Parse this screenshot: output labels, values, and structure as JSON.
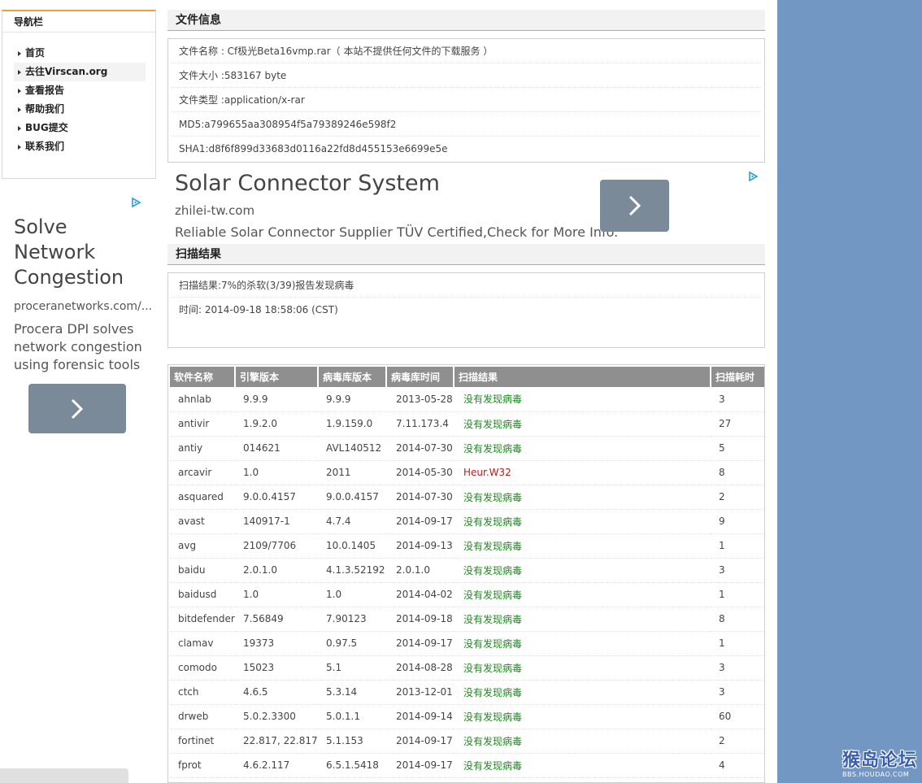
{
  "nav": {
    "title": "导航栏",
    "items": [
      {
        "label": "首页"
      },
      {
        "label": "去往Virscan.org"
      },
      {
        "label": "查看报告"
      },
      {
        "label": "帮助我们"
      },
      {
        "label": "BUG提交"
      },
      {
        "label": "联系我们"
      }
    ]
  },
  "ad_left": {
    "title": "Solve Network Congestion",
    "domain": "proceranetworks.com/...",
    "description": "Procera DPI solves network congestion using forensic tools"
  },
  "file_info": {
    "heading": "文件信息",
    "rows": [
      "文件名称 : Cf极光Beta16vmp.rar（ 本站不提供任何文件的下载服务 ）",
      "文件大小 :583167 byte",
      "文件类型 :application/x-rar",
      "MD5:a799655aa308954f5a79389246e598f2",
      "SHA1:d8f6f899d33683d0116a22fd8d455153e6699e5e"
    ]
  },
  "ad_top": {
    "title": "Solar Connector System",
    "domain": "zhilei-tw.com",
    "description": "Reliable Solar Connector Supplier TÜV Certified,Check for More Info."
  },
  "scan": {
    "heading": "扫描结果",
    "summary": "扫描结果:7%的杀软(3/39)报告发现病毒",
    "time": "时间: 2014-09-18 18:58:06 (CST)"
  },
  "results_table": {
    "headers": [
      "软件名称",
      "引擎版本",
      "病毒库版本",
      "病毒库时间",
      "扫描结果",
      "扫描耗时"
    ],
    "rows": [
      {
        "name": "ahnlab",
        "engine": "9.9.9",
        "db_version": "9.9.9",
        "db_time": "2013-05-28",
        "result": "没有发现病毒",
        "status": "ok",
        "duration": "3"
      },
      {
        "name": "antivir",
        "engine": "1.9.2.0",
        "db_version": "1.9.159.0",
        "db_time": "7.11.173.4",
        "result": "没有发现病毒",
        "status": "ok",
        "duration": "27"
      },
      {
        "name": "antiy",
        "engine": "014621",
        "db_version": "AVL140512",
        "db_time": "2014-07-30",
        "result": "没有发现病毒",
        "status": "ok",
        "duration": "5"
      },
      {
        "name": "arcavir",
        "engine": "1.0",
        "db_version": "2011",
        "db_time": "2014-05-30",
        "result": "Heur.W32",
        "status": "bad",
        "duration": "8"
      },
      {
        "name": "asquared",
        "engine": "9.0.0.4157",
        "db_version": "9.0.0.4157",
        "db_time": "2014-07-30",
        "result": "没有发现病毒",
        "status": "ok",
        "duration": "2"
      },
      {
        "name": "avast",
        "engine": "140917-1",
        "db_version": "4.7.4",
        "db_time": "2014-09-17",
        "result": "没有发现病毒",
        "status": "ok",
        "duration": "9"
      },
      {
        "name": "avg",
        "engine": "2109/7706",
        "db_version": "10.0.1405",
        "db_time": "2014-09-13",
        "result": "没有发现病毒",
        "status": "ok",
        "duration": "1"
      },
      {
        "name": "baidu",
        "engine": "2.0.1.0",
        "db_version": "4.1.3.52192",
        "db_time": "2.0.1.0",
        "result": "没有发现病毒",
        "status": "ok",
        "duration": "3"
      },
      {
        "name": "baidusd",
        "engine": "1.0",
        "db_version": "1.0",
        "db_time": "2014-04-02",
        "result": "没有发现病毒",
        "status": "ok",
        "duration": "1"
      },
      {
        "name": "bitdefender",
        "engine": "7.56849",
        "db_version": "7.90123",
        "db_time": "2014-09-18",
        "result": "没有发现病毒",
        "status": "ok",
        "duration": "8"
      },
      {
        "name": "clamav",
        "engine": "19373",
        "db_version": "0.97.5",
        "db_time": "2014-09-17",
        "result": "没有发现病毒",
        "status": "ok",
        "duration": "1"
      },
      {
        "name": "comodo",
        "engine": "15023",
        "db_version": "5.1",
        "db_time": "2014-08-28",
        "result": "没有发现病毒",
        "status": "ok",
        "duration": "3"
      },
      {
        "name": "ctch",
        "engine": "4.6.5",
        "db_version": "5.3.14",
        "db_time": "2013-12-01",
        "result": "没有发现病毒",
        "status": "ok",
        "duration": "3"
      },
      {
        "name": "drweb",
        "engine": "5.0.2.3300",
        "db_version": "5.0.1.1",
        "db_time": "2014-09-14",
        "result": "没有发现病毒",
        "status": "ok",
        "duration": "60"
      },
      {
        "name": "fortinet",
        "engine": "22.817, 22.817",
        "db_version": "5.1.153",
        "db_time": "2014-09-17",
        "result": "没有发现病毒",
        "status": "ok",
        "duration": "2"
      },
      {
        "name": "fprot",
        "engine": "4.6.2.117",
        "db_version": "6.5.1.5418",
        "db_time": "2014-09-17",
        "result": "没有发现病毒",
        "status": "ok",
        "duration": "4"
      }
    ]
  },
  "watermark": {
    "main": "猴岛论坛",
    "sub": "BBS.HOUDAO.COM"
  },
  "colors": {
    "accent": "#e6a23c",
    "sidebar_right": "#7197c2",
    "table_header": "#8f8f8f",
    "clean": "#1e8a1e",
    "infected": "#b51c1c",
    "ad_button": "#7a8a99"
  }
}
